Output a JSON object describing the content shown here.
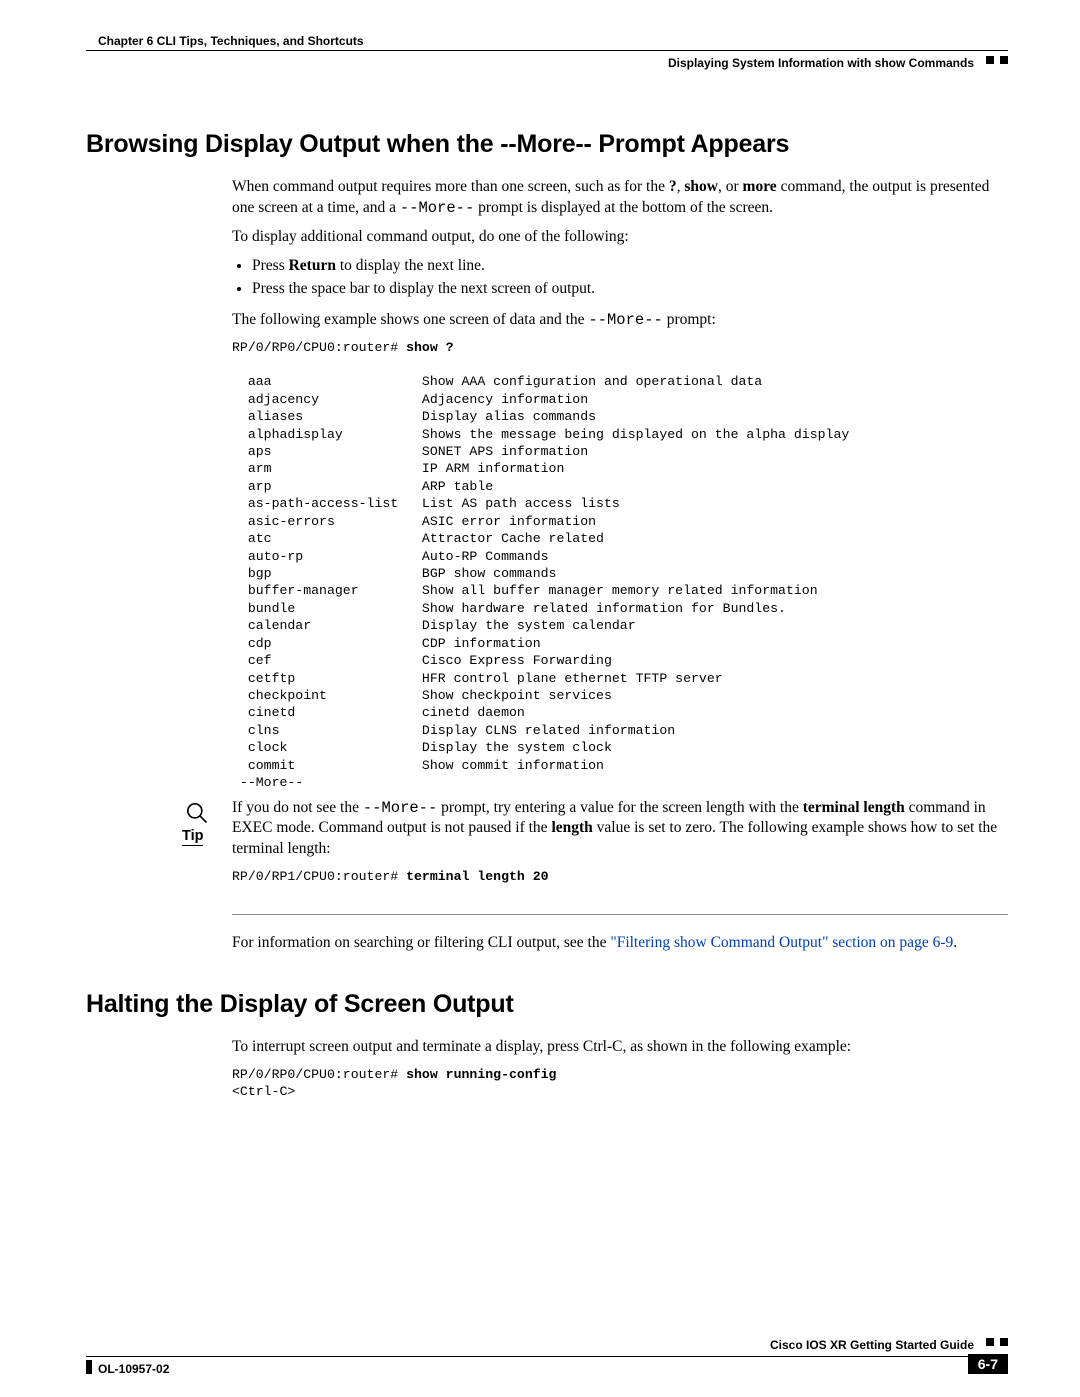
{
  "header": {
    "left": "Chapter 6    CLI Tips, Techniques, and Shortcuts",
    "right": "Displaying System Information with show Commands"
  },
  "section1": {
    "title": "Browsing Display Output when the --More-- Prompt Appears",
    "p1a": "When command output requires more than one screen, such as for the ",
    "p1b": ", ",
    "p1c": ", or ",
    "p1d": " command, the output is presented one screen at a time, and a ",
    "p1e": " prompt is displayed at the bottom of the screen.",
    "bold_q": "?",
    "bold_show": "show",
    "bold_more": "more",
    "mono_more": "--More--",
    "p2": "To display additional command output, do one of the following:",
    "bullets": {
      "b1a": "Press ",
      "b1b": "Return",
      "b1c": " to display the next line.",
      "b2": "Press the space bar to display the next screen of output."
    },
    "p3a": "The following example shows one screen of data and the ",
    "p3b": " prompt:",
    "code_prompt_prefix": "RP/0/RP0/CPU0:router# ",
    "code_prompt_bold": "show ?",
    "code_rows": [
      [
        "aaa",
        "Show AAA configuration and operational data"
      ],
      [
        "adjacency",
        "Adjacency information"
      ],
      [
        "aliases",
        "Display alias commands"
      ],
      [
        "alphadisplay",
        "Shows the message being displayed on the alpha display"
      ],
      [
        "aps",
        "SONET APS information"
      ],
      [
        "arm",
        "IP ARM information"
      ],
      [
        "arp",
        "ARP table"
      ],
      [
        "as-path-access-list",
        "List AS path access lists"
      ],
      [
        "asic-errors",
        "ASIC error information"
      ],
      [
        "atc",
        "Attractor Cache related"
      ],
      [
        "auto-rp",
        "Auto-RP Commands"
      ],
      [
        "bgp",
        "BGP show commands"
      ],
      [
        "buffer-manager",
        "Show all buffer manager memory related information"
      ],
      [
        "bundle",
        "Show hardware related information for Bundles."
      ],
      [
        "calendar",
        "Display the system calendar"
      ],
      [
        "cdp",
        "CDP information"
      ],
      [
        "cef",
        "Cisco Express Forwarding"
      ],
      [
        "cetftp",
        "HFR control plane ethernet TFTP server"
      ],
      [
        "checkpoint",
        "Show checkpoint services"
      ],
      [
        "cinetd",
        "cinetd daemon"
      ],
      [
        "clns",
        "Display CLNS related information"
      ],
      [
        "clock",
        "Display the system clock"
      ],
      [
        "commit",
        "Show commit information"
      ]
    ],
    "code_more": " --More--"
  },
  "tip": {
    "label": "Tip",
    "p1a": "If you do not see the ",
    "p1b": " prompt, try entering a value for the screen length with the ",
    "p1c": " command in EXEC mode. Command output is not paused if the ",
    "p1d": " value is set to zero. The following example shows how to set the terminal length:",
    "bold_terminal_length": "terminal length",
    "bold_length": "length",
    "code_prefix": "RP/0/RP1/CPU0:router# ",
    "code_bold": "terminal length 20"
  },
  "xref": {
    "pre": "For information on searching or filtering CLI output, see the ",
    "link": "\"Filtering show Command Output\" section on page 6-9",
    "post": "."
  },
  "section2": {
    "title": "Halting the Display of Screen Output",
    "p1": "To interrupt screen output and terminate a display, press Ctrl-C, as shown in the following example:",
    "code_prefix": "RP/0/RP0/CPU0:router# ",
    "code_bold": "show running-config",
    "code_line2": "<Ctrl-C>"
  },
  "footer": {
    "guide": "Cisco IOS XR Getting Started Guide",
    "doc": "OL-10957-02",
    "page": "6-7"
  }
}
